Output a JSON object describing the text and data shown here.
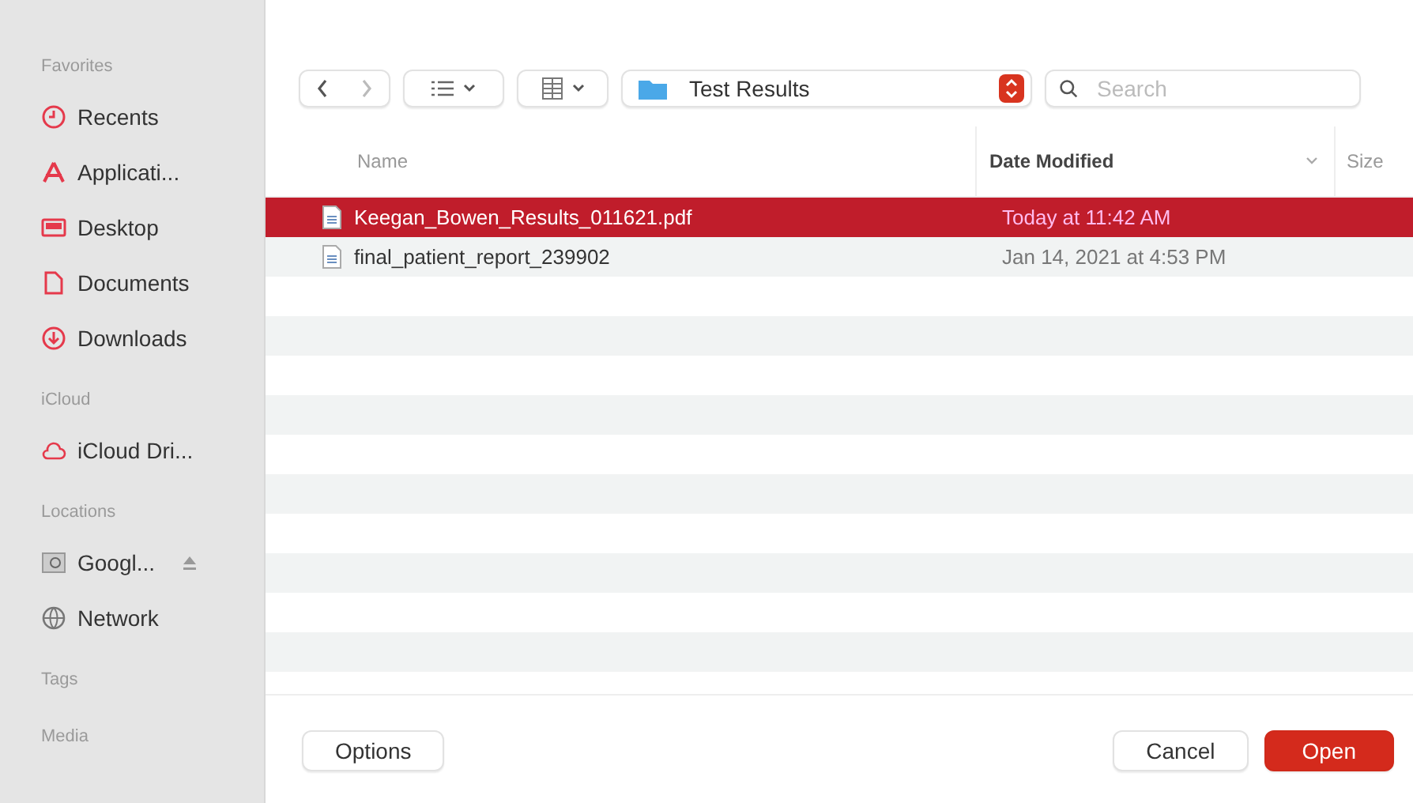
{
  "sidebar": {
    "sections": [
      {
        "title": "Favorites",
        "items": [
          {
            "label": "Recents",
            "kind": "clock"
          },
          {
            "label": "Applicati...",
            "kind": "apps"
          },
          {
            "label": "Desktop",
            "kind": "desktop"
          },
          {
            "label": "Documents",
            "kind": "document"
          },
          {
            "label": "Downloads",
            "kind": "download"
          }
        ]
      },
      {
        "title": "iCloud",
        "items": [
          {
            "label": "iCloud Dri...",
            "kind": "cloud"
          }
        ]
      },
      {
        "title": "Locations",
        "items": [
          {
            "label": "Googl...",
            "kind": "drive",
            "ejectable": true
          },
          {
            "label": "Network",
            "kind": "network"
          }
        ]
      },
      {
        "title": "Tags"
      },
      {
        "title": "Media"
      }
    ]
  },
  "toolbar": {
    "location": "Test Results",
    "search": {
      "placeholder": "Search"
    }
  },
  "table": {
    "columns": [
      "Name",
      "Date Modified",
      "Size"
    ],
    "rows": [
      {
        "name": "Keegan_Bowen_Results_011621.pdf",
        "date": "Today at 11:42 AM",
        "selected": true
      },
      {
        "name": "final_patient_report_239902",
        "date": "Jan 14, 2021 at 4:53 PM",
        "selected": false
      }
    ]
  },
  "buttons": {
    "options": "Options",
    "cancel": "Cancel",
    "open": "Open"
  }
}
